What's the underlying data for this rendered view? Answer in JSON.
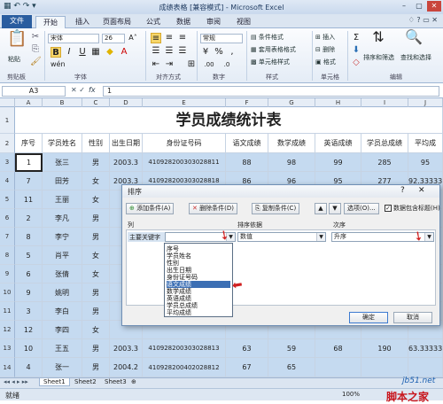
{
  "window": {
    "title": "成绩表格 [兼容模式] - Microsoft Excel",
    "controls": [
      "–",
      "▢",
      "✕"
    ]
  },
  "tabs": [
    "文件",
    "开始",
    "插入",
    "页面布局",
    "公式",
    "数据",
    "审阅",
    "视图"
  ],
  "ribbon": {
    "clipboard": {
      "label": "剪贴板",
      "paste": "粘贴"
    },
    "font": {
      "label": "字体",
      "name": "宋体",
      "size": "26"
    },
    "align": {
      "label": "对齐方式"
    },
    "number": {
      "label": "数字",
      "format": "常规"
    },
    "styles": {
      "label": "样式",
      "cond": "条件格式",
      "table": "套用表格格式",
      "cell": "单元格样式"
    },
    "cells": {
      "label": "单元格",
      "insert": "插入",
      "delete": "删除",
      "format": "格式"
    },
    "editing": {
      "label": "编辑",
      "sort": "排序和筛选",
      "find": "查找和选择"
    }
  },
  "formula_bar": {
    "name_box": "A3",
    "fx": "fx",
    "value": "1"
  },
  "columns": [
    "A",
    "B",
    "C",
    "D",
    "E",
    "F",
    "G",
    "H",
    "I",
    "J"
  ],
  "sheet": {
    "title": "学员成绩统计表",
    "headers": [
      "序号",
      "学员姓名",
      "性别",
      "出生日期",
      "身份证号码",
      "语文成绩",
      "数学成绩",
      "英语成绩",
      "学员总成绩",
      "平均成"
    ],
    "row_numbers": [
      "1",
      "2",
      "3",
      "4",
      "5",
      "6",
      "7",
      "8",
      "9",
      "10",
      "11",
      "12",
      "13",
      "14"
    ],
    "rows": [
      [
        "1",
        "张三",
        "男",
        "2003.3",
        "410928200303028811",
        "88",
        "98",
        "99",
        "285",
        "95"
      ],
      [
        "7",
        "田芳",
        "女",
        "2003.3",
        "410928200303028818",
        "86",
        "96",
        "95",
        "277",
        "92.33333"
      ],
      [
        "11",
        "王丽",
        "女",
        "",
        "",
        "",
        "",
        "",
        "",
        ""
      ],
      [
        "2",
        "李凡",
        "男",
        "",
        "",
        "",
        "",
        "",
        "",
        ""
      ],
      [
        "8",
        "李宁",
        "男",
        "",
        "",
        "",
        "",
        "",
        "",
        ""
      ],
      [
        "5",
        "肖平",
        "女",
        "",
        "",
        "",
        "",
        "",
        "",
        ""
      ],
      [
        "6",
        "张倩",
        "女",
        "",
        "",
        "",
        "",
        "",
        "",
        ""
      ],
      [
        "9",
        "姚明",
        "男",
        "",
        "",
        "",
        "",
        "",
        "",
        ""
      ],
      [
        "3",
        "李白",
        "男",
        "",
        "",
        "",
        "",
        "",
        "",
        ""
      ],
      [
        "12",
        "李四",
        "女",
        "",
        "",
        "",
        "",
        "",
        "",
        ""
      ],
      [
        "10",
        "王五",
        "男",
        "2003.3",
        "410928200303028813",
        "63",
        "59",
        "68",
        "190",
        "63.33333"
      ],
      [
        "4",
        "张一",
        "男",
        "2004.2",
        "410928200402028812",
        "67",
        "65",
        "",
        "",
        ""
      ]
    ]
  },
  "sheet_tabs": [
    "Sheet1",
    "Sheet2",
    "Sheet3"
  ],
  "status": {
    "ready": "就绪",
    "zoom": "100%",
    "watermark1": "jb51.net",
    "watermark2": "脚本之家"
  },
  "dialog": {
    "title": "排序",
    "help": "?",
    "close": "✕",
    "add_level": "添加条件(A)",
    "delete_level": "删除条件(D)",
    "copy_level": "复制条件(C)",
    "options": "选项(O)...",
    "has_headers": "数据包含标题(H)",
    "col_header": "列",
    "sort_on_header": "排序依据",
    "order_header": "次序",
    "main_key_label": "主要关键字",
    "sort_on_value": "数值",
    "order_value": "升序",
    "ok": "确定",
    "cancel": "取消",
    "dropdown_items": [
      "序号",
      "学员姓名",
      "性别",
      "出生日期",
      "身份证号码",
      "语文成绩",
      "数学成绩",
      "英语成绩",
      "学员总成绩",
      "平均成绩"
    ],
    "dropdown_highlighted": "语文成绩"
  }
}
